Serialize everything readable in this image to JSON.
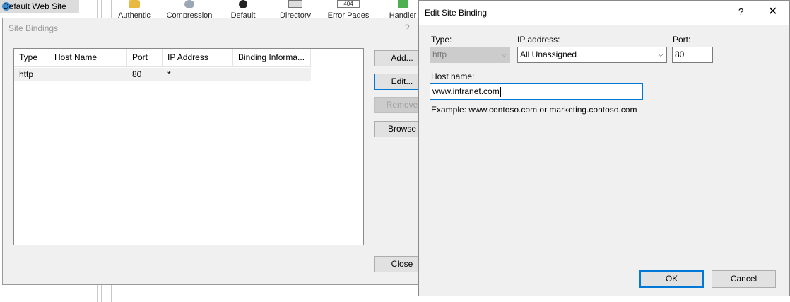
{
  "background": {
    "tree_item": "Default Web Site",
    "features": [
      "Authentic",
      "Compression",
      "Default",
      "Directory",
      "Error Pages",
      "Handler"
    ],
    "error_badge": "404",
    "right_link": "basic_settings"
  },
  "site_bindings": {
    "title": "Site Bindings",
    "help": "?",
    "columns": [
      "Type",
      "Host Name",
      "Port",
      "IP Address",
      "Binding Informa..."
    ],
    "rows": [
      {
        "type": "http",
        "host_name": "",
        "port": "80",
        "ip_address": "*",
        "binding_info": ""
      }
    ],
    "buttons": {
      "add": "Add...",
      "edit": "Edit...",
      "remove": "Remove",
      "browse": "Browse",
      "close": "Close"
    }
  },
  "edit_binding": {
    "title": "Edit Site Binding",
    "help": "?",
    "close": "✕",
    "type_label": "Type:",
    "type_value": "http",
    "ip_label": "IP address:",
    "ip_value": "All Unassigned",
    "port_label": "Port:",
    "port_value": "80",
    "host_label": "Host name:",
    "host_value": "www.intranet.com",
    "example": "Example: www.contoso.com or marketing.contoso.com",
    "ok": "OK",
    "cancel": "Cancel"
  },
  "colors": {
    "accent": "#0078d7",
    "dialog_bg": "#f0f0f0",
    "disabled": "#cccccc"
  }
}
